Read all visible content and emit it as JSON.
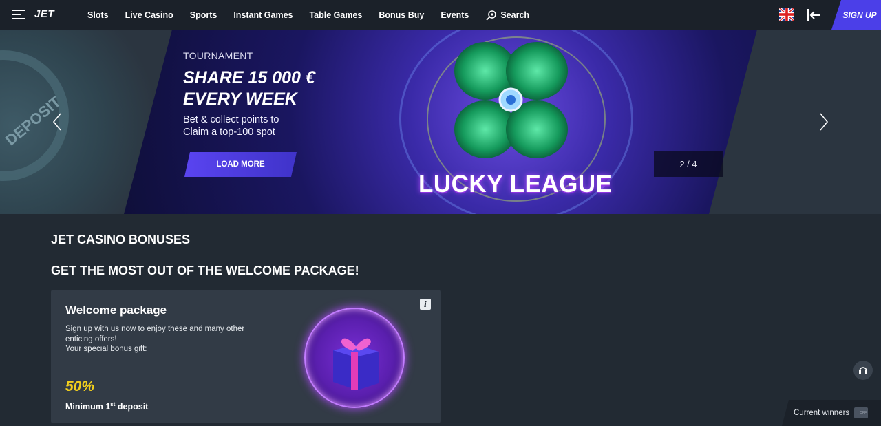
{
  "header": {
    "logo": "JET",
    "nav": [
      "Slots",
      "Live Casino",
      "Sports",
      "Instant Games",
      "Table Games",
      "Bonus Buy",
      "Events"
    ],
    "search_label": "Search",
    "signup_label": "SIGN UP",
    "language_icon": "uk-flag-icon",
    "login_icon": "login-icon"
  },
  "hero": {
    "kicker": "TOURNAMENT",
    "title_line1": "SHARE 15 000 €",
    "title_line2": "EVERY WEEK",
    "desc_line1": "Bet & collect points to",
    "desc_line2": "Claim a top-100 spot",
    "cta": "LOAD MORE",
    "logo_text": "LUCKY LEAGUE",
    "pager": "2 / 4",
    "side_text": "DEPOSIT"
  },
  "content": {
    "heading": "JET CASINO BONUSES",
    "subheading": "GET THE MOST OUT OF THE WELCOME PACKAGE!",
    "card": {
      "title": "Welcome package",
      "desc_line1": "Sign up with us now to enjoy these and many other",
      "desc_line2": "enticing offers!",
      "desc_line3": "Your special bonus gift:",
      "percent": "50%",
      "min_deposit_prefix": "Minimum 1",
      "min_deposit_sup": "st",
      "min_deposit_suffix": " deposit",
      "info": "i"
    }
  },
  "footer": {
    "winners_label": "Current winners",
    "toggle_state": "OFF"
  },
  "colors": {
    "accent": "#4b3fe8",
    "bonus_yellow": "#f2cf1d",
    "background": "#222a33"
  }
}
